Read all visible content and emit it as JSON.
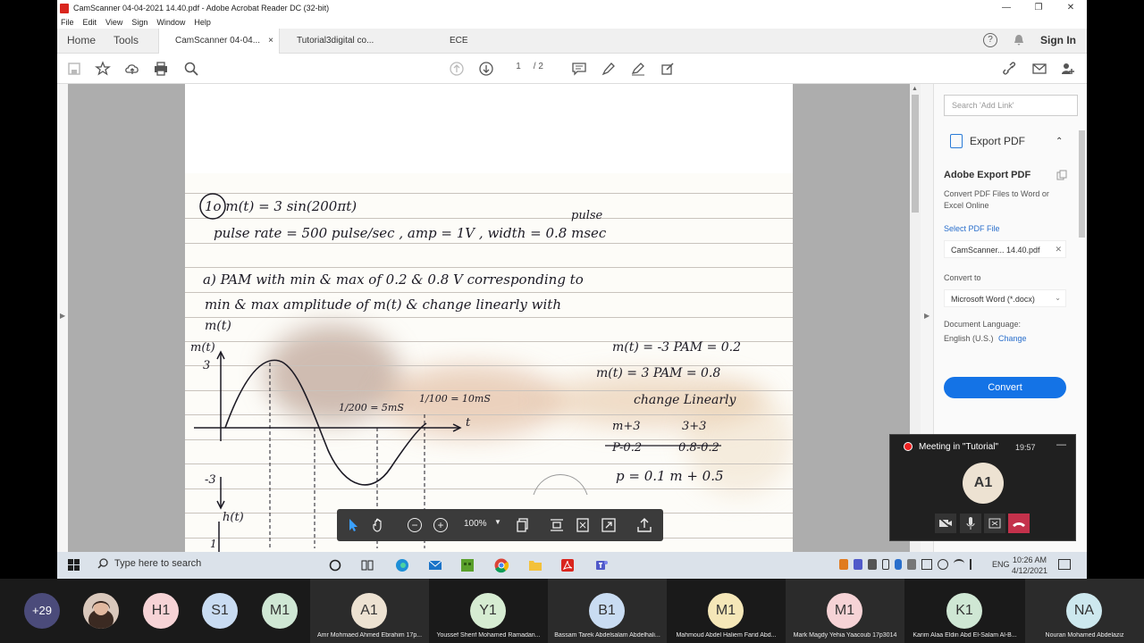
{
  "window": {
    "title": "CamScanner 04-04-2021 14.40.pdf - Adobe Acrobat Reader DC (32-bit)",
    "minimize": "—",
    "maximize": "❐",
    "close": "✕"
  },
  "menu": [
    "File",
    "Edit",
    "View",
    "Sign",
    "Window",
    "Help"
  ],
  "tabs": {
    "home": "Home",
    "tools": "Tools",
    "docs": [
      {
        "label": "CamScanner 04-04...",
        "close": "×"
      },
      {
        "label": "Tutorial3digital co..."
      },
      {
        "label": "ECE"
      }
    ],
    "help_icon": "?",
    "sign_in": "Sign In"
  },
  "toolbar": {
    "page_current": "1",
    "page_total": "/ 2"
  },
  "document": {
    "lines": [
      "1o m(t) = 3 sin(200πt)",
      "pulse",
      "pulse rate = 500 pulse/sec , amp = 1V , width = 0.8 msec",
      "a) PAM with  min & max of 0.2 & 0.8 V  corresponding to",
      "min & max amplitude of m(t) & change linearly with",
      "m(t)",
      "m(t)",
      "3",
      "-3",
      "m(t) = -3    PAM = 0.2",
      "m(t) = 3     PAM = 0.8",
      "change Linearly",
      "1/200 = 5mS",
      "1/100 = 10mS",
      "t",
      "m+3",
      "3+3",
      "P-0.2",
      "0.8-0.2",
      "p = 0.1 m + 0.5",
      "h(t)",
      "1"
    ]
  },
  "rightpanel": {
    "search_placeholder": "Search 'Add Link'",
    "export_title": "Export PDF",
    "chevron": "⌃",
    "adobe_export": "Adobe Export PDF",
    "desc": "Convert PDF Files to Word or Excel Online",
    "select_label": "Select PDF File",
    "file_name": "CamScanner... 14.40.pdf",
    "file_remove": "✕",
    "convert_to": "Convert to",
    "format": "Microsoft Word (*.docx)",
    "doc_language": "Document Language:",
    "language": "English (U.S.)",
    "change": "Change",
    "convert_button": "Convert"
  },
  "meeting": {
    "title": "Meeting in \"Tutorial\"",
    "time": "19:57",
    "minimize": "—",
    "avatar": "A1"
  },
  "floatbar": {
    "zoom": "100%",
    "dropdown": "▼"
  },
  "taskbar": {
    "search_placeholder": "Type here to search",
    "lang": "ENG",
    "time": "10:26 AM",
    "date": "4/12/2021"
  },
  "participants": [
    {
      "initials": "+29",
      "color": "#4b4b7a",
      "name": ""
    },
    {
      "initials": "",
      "color": "#8a6a58",
      "name": ""
    },
    {
      "initials": "H1",
      "color": "#f6d3d6",
      "name": ""
    },
    {
      "initials": "S1",
      "color": "#c9dcf2",
      "name": ""
    },
    {
      "initials": "M1",
      "color": "#cfe7d4",
      "name": ""
    },
    {
      "initials": "A1",
      "color": "#ede2d2",
      "name": "Amr Mohmaed Ahmed Ebrahim 17p..."
    },
    {
      "initials": "Y1",
      "color": "#d6ecd2",
      "name": "Youssef Sherif Mohamed Ramadan..."
    },
    {
      "initials": "B1",
      "color": "#c9dcf2",
      "name": "Bassam Tarek Abdelsalam Abdelhali..."
    },
    {
      "initials": "M1",
      "color": "#f5e7b8",
      "name": "Mahmoud Abdel Haliem Farid Abd..."
    },
    {
      "initials": "M1",
      "color": "#f6d3d6",
      "name": "Mark Magdy Yehia Yaacoub 17p3014"
    },
    {
      "initials": "K1",
      "color": "#cfe7d4",
      "name": "Karim Alaa Eldin Abd El-Salam Al-B..."
    },
    {
      "initials": "NA",
      "color": "#cde8ee",
      "name": "Nouran Mohamed Abdelaziz"
    }
  ]
}
